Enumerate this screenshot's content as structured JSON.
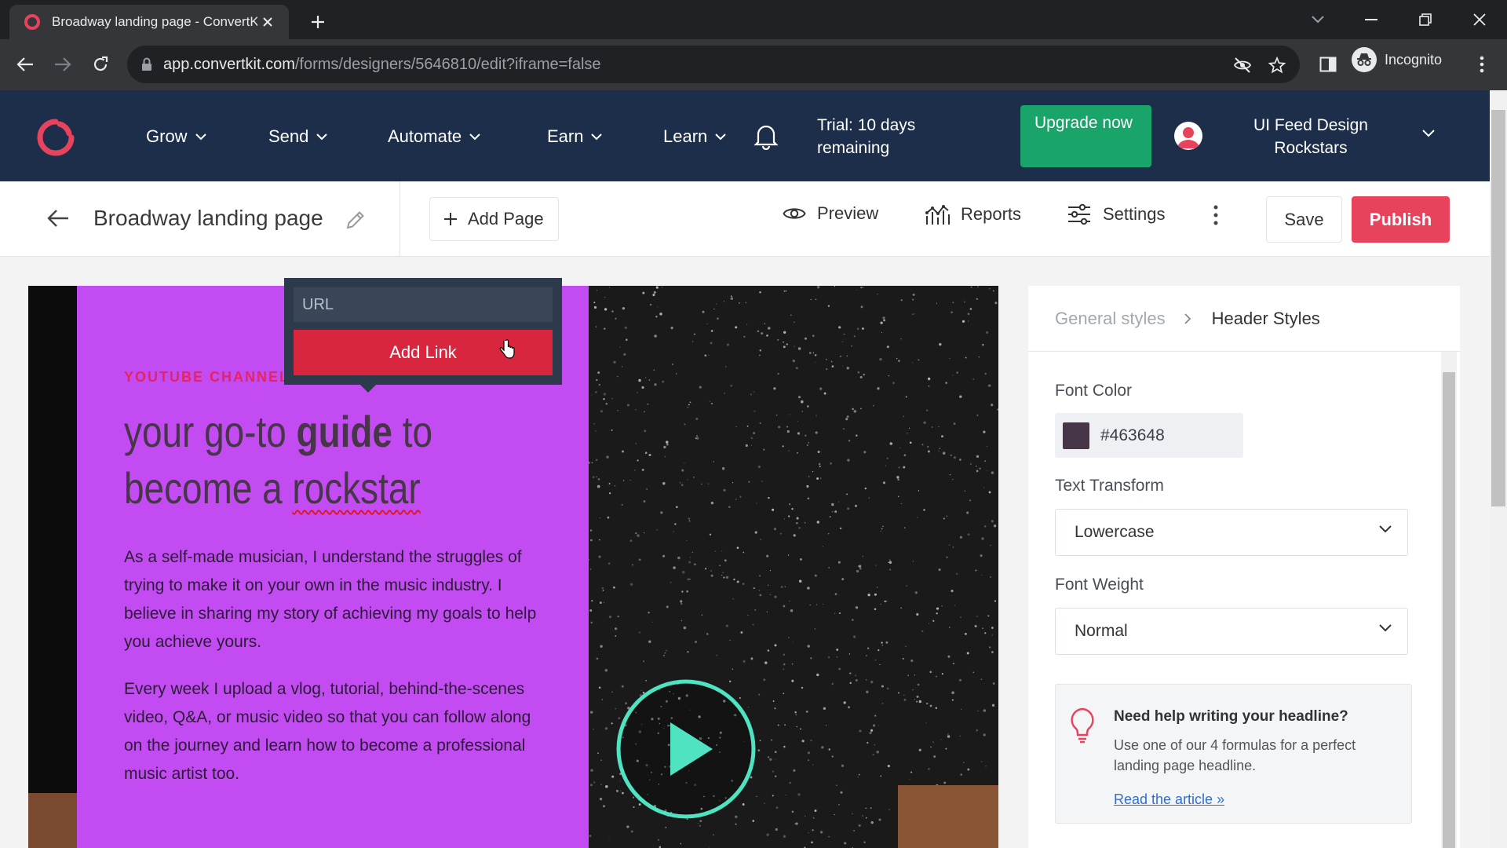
{
  "browser": {
    "tab_title": "Broadway landing page - ConvertKit",
    "url_host": "app.convertkit.com",
    "url_path": "/forms/designers/5646810/edit?iframe=false",
    "incognito_label": "Incognito"
  },
  "nav": {
    "items": [
      {
        "label": "Grow"
      },
      {
        "label": "Send"
      },
      {
        "label": "Automate"
      },
      {
        "label": "Earn"
      },
      {
        "label": "Learn"
      }
    ],
    "trial_text": "Trial: 10 days remaining",
    "upgrade_label": "Upgrade now",
    "account_name": "UI Feed Design Rockstars"
  },
  "editor": {
    "page_title": "Broadway landing page",
    "add_page_label": "Add Page",
    "preview_label": "Preview",
    "reports_label": "Reports",
    "settings_label": "Settings",
    "save_label": "Save",
    "publish_label": "Publish"
  },
  "link_popup": {
    "url_placeholder": "URL",
    "add_link_label": "Add Link"
  },
  "landing": {
    "eyebrow": "YOUTUBE CHANNEL",
    "headline_part1": "your go-to ",
    "headline_bold": "guide",
    "headline_part2": " to become a ",
    "headline_part3": "rockstar",
    "paragraph1": "As a self-made musician, I understand the struggles of trying to make it on your own in the music industry. I believe in sharing my story of achieving my goals to help you achieve yours.",
    "paragraph2": "Every week I upload a vlog, tutorial, behind-the-scenes video, Q&A, or music video so that you can follow along on the journey and learn how to become a professional music artist too."
  },
  "panel": {
    "crumb_general": "General styles",
    "crumb_current": "Header Styles",
    "font_color_label": "Font Color",
    "font_color_value": "#463648",
    "text_transform_label": "Text Transform",
    "text_transform_value": "Lowercase",
    "font_weight_label": "Font Weight",
    "font_weight_value": "Normal",
    "help_title": "Need help writing your headline?",
    "help_body": "Use one of our 4 formulas for a perfect landing page headline.",
    "help_link": "Read the article »"
  },
  "colors": {
    "nav_bg": "#1c2e4a",
    "upgrade_bg": "#19a46a",
    "publish_bg": "#e8435c",
    "landing_purple": "#c24cf2",
    "headline_color": "#463648",
    "eyebrow_color": "#e7245e",
    "play_ring": "#4fe3c1"
  }
}
